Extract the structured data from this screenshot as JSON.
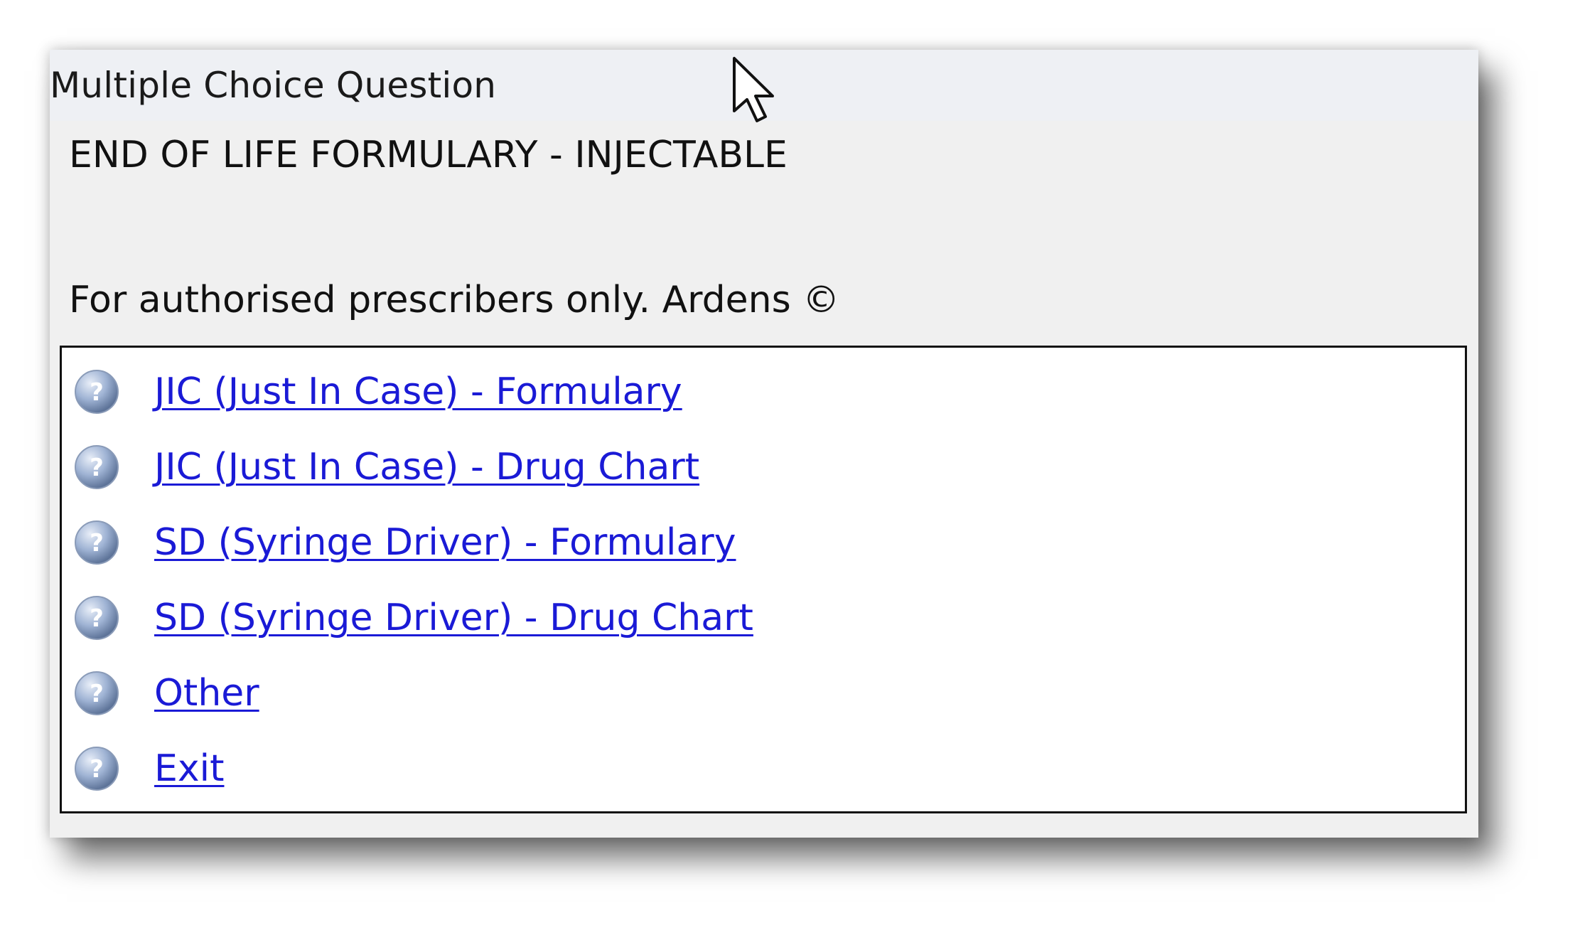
{
  "window": {
    "title": "Multiple Choice Question"
  },
  "heading": "END OF LIFE FORMULARY - INJECTABLE",
  "subtext": "For authorised prescribers only. Ardens ©",
  "options": [
    {
      "label": "JIC (Just In Case) - Formulary",
      "icon": "question-icon"
    },
    {
      "label": "JIC (Just In Case) - Drug Chart",
      "icon": "question-icon"
    },
    {
      "label": "SD (Syringe Driver) - Formulary",
      "icon": "question-icon"
    },
    {
      "label": "SD (Syringe Driver) - Drug Chart",
      "icon": "question-icon"
    },
    {
      "label": "Other",
      "icon": "question-icon"
    },
    {
      "label": "Exit",
      "icon": "question-icon"
    }
  ],
  "colors": {
    "link": "#1a1ad6",
    "dialog_bg": "#f0f0f0",
    "titlebar_bg": "#eef0f4"
  }
}
